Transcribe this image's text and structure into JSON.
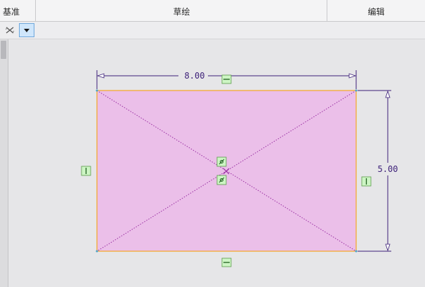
{
  "ribbon": {
    "groups": [
      "基准",
      "草绘",
      "编辑"
    ]
  },
  "toolbar": {
    "buttons": [
      {
        "name": "close-filter-button",
        "icon": "close-x-icon"
      },
      {
        "name": "filter-dropdown-button",
        "icon": "triangle-down-icon"
      }
    ]
  },
  "sketch": {
    "width_dimension": "8.00",
    "height_dimension": "5.00",
    "colors": {
      "canvas": "#e6e6e8",
      "fill": "#ebbfe9",
      "edge": "#f5a623",
      "dimension": "#3c1f78",
      "construction": "#9a2fa3",
      "constraint_bg": "#cdf5c4",
      "constraint_border": "#5a9a4a"
    },
    "constraints": [
      "horizontal",
      "horizontal",
      "vertical",
      "vertical",
      "midpoint",
      "midpoint"
    ]
  }
}
